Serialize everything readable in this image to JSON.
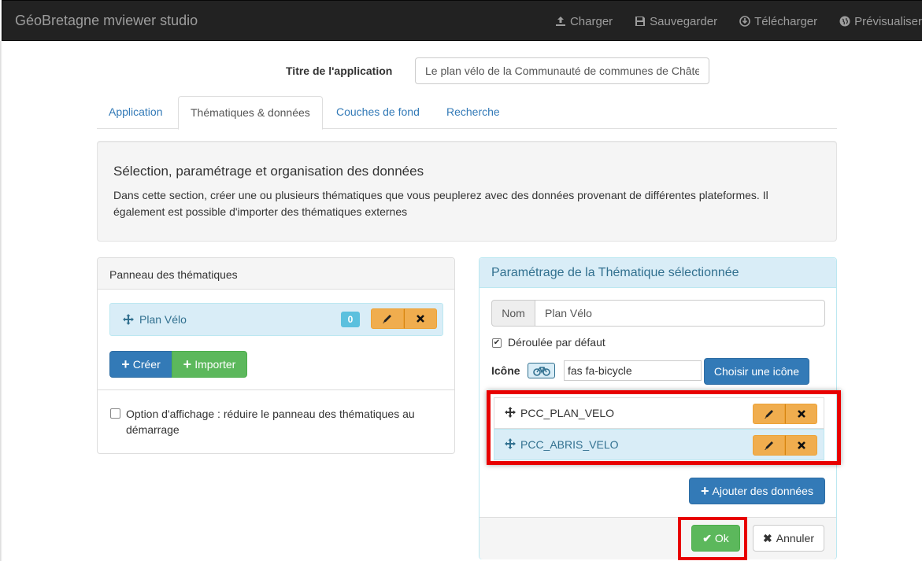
{
  "navbar": {
    "brand": "GéoBretagne mviewer studio",
    "links": [
      {
        "label": "Charger",
        "icon": "upload-icon"
      },
      {
        "label": "Sauvegarder",
        "icon": "floppy-disk-icon"
      },
      {
        "label": "Télécharger",
        "icon": "download-circle-icon"
      },
      {
        "label": "Prévisualiser",
        "icon": "globe-icon"
      }
    ]
  },
  "app_title": {
    "label": "Titre de l'application",
    "value": "Le plan vélo de la Communauté de communes de Châte"
  },
  "tabs": [
    {
      "label": "Application",
      "active": false
    },
    {
      "label": "Thématiques & données",
      "active": true
    },
    {
      "label": "Couches de fond",
      "active": false
    },
    {
      "label": "Recherche",
      "active": false
    }
  ],
  "intro": {
    "heading": "Sélection, paramétrage et organisation des données",
    "text": "Dans cette section, créer une ou plusieurs thématiques que vous peuplerez avec des données provenant de différentes plateformes. Il également est possible d'importer des thématiques externes"
  },
  "themes_panel": {
    "title": "Panneau des thématiques",
    "items": [
      {
        "label": "Plan Vélo",
        "count": "0"
      }
    ],
    "create_label": "Créer",
    "import_label": "Importer",
    "option_label": "Option d'affichage : réduire le panneau des thématiques au démarrage"
  },
  "settings_panel": {
    "title": "Paramétrage de la Thématique sélectionnée",
    "nom_label": "Nom",
    "nom_value": "Plan Vélo",
    "collapsed_label": "Déroulée par défaut",
    "icon_label": "Icône",
    "icon_value": "fas fa-bicycle",
    "choose_icon_label": "Choisir une icône",
    "layers": [
      {
        "name": "PCC_PLAN_VELO",
        "selected": false
      },
      {
        "name": "PCC_ABRIS_VELO",
        "selected": true
      }
    ],
    "add_data_label": "Ajouter des données",
    "ok_label": "Ok",
    "cancel_label": "Annuler"
  },
  "colors": {
    "primary": "#337ab7",
    "success": "#5cb85c",
    "warning": "#f0ad4e",
    "info": "#5bc0de",
    "highlight": "#e80000"
  }
}
